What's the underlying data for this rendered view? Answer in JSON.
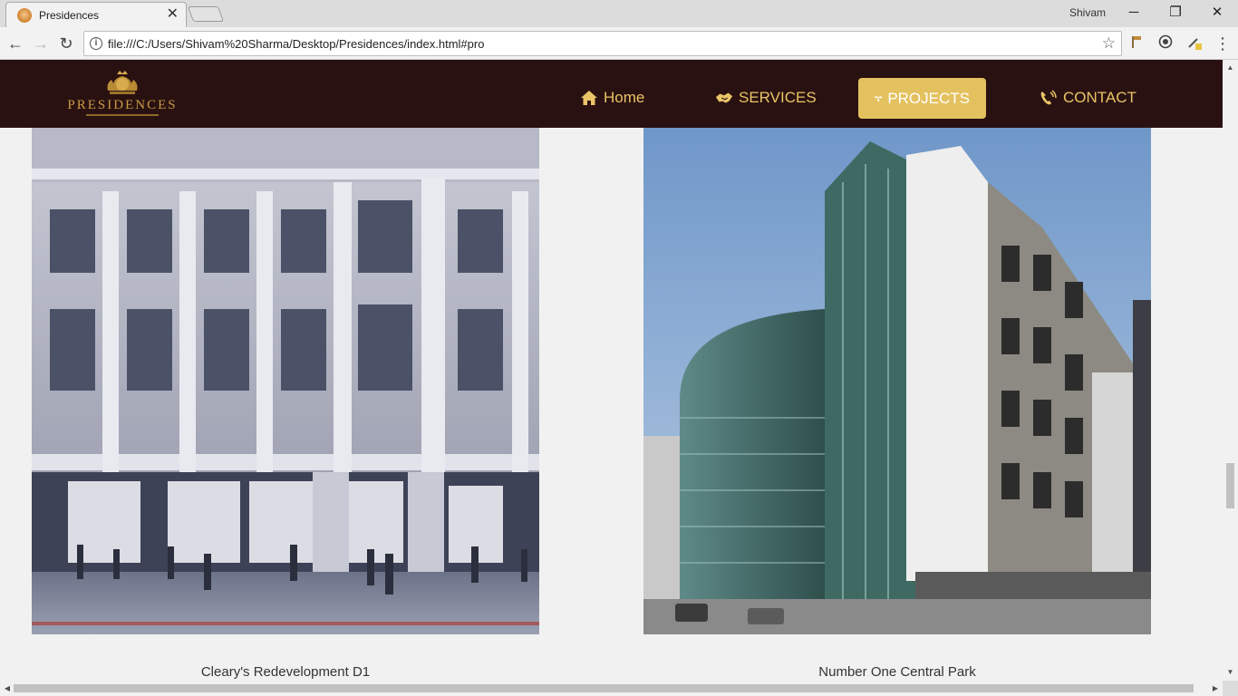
{
  "browser": {
    "tab": {
      "title": "Presidences",
      "close": "✕"
    },
    "user": "Shivam",
    "window": {
      "minimize": "─",
      "restore": "❐",
      "close": "✕"
    },
    "nav": {
      "back": "←",
      "forward": "→",
      "reload": "↻"
    },
    "address": {
      "url": "file:///C:/Users/Shivam%20Sharma/Desktop/Presidences/index.html#pro",
      "info": "i",
      "star": "☆"
    },
    "extensions": [
      "bookmark-flag-icon",
      "record-icon",
      "eyedropper-icon"
    ],
    "menu": "⋮"
  },
  "site": {
    "logo": {
      "text": "PRESIDENCES"
    },
    "nav": [
      {
        "label": "Home",
        "icon": "home-icon",
        "active": false
      },
      {
        "label": "SERVICES",
        "icon": "handshake-icon",
        "active": false
      },
      {
        "label": "PROJECTS",
        "icon": "sitemap-icon",
        "active": true
      },
      {
        "label": "CONTACT",
        "icon": "phone-icon",
        "active": false
      }
    ],
    "colors": {
      "nav_bg": "#2a1111",
      "accent": "#e4c15f",
      "nav_text": "#e9c467"
    }
  },
  "projects": [
    {
      "caption": "Cleary's Redevelopment D1",
      "image": "neoclassical-storefront-building"
    },
    {
      "caption": "Number One Central Park",
      "image": "glass-office-tower"
    }
  ]
}
